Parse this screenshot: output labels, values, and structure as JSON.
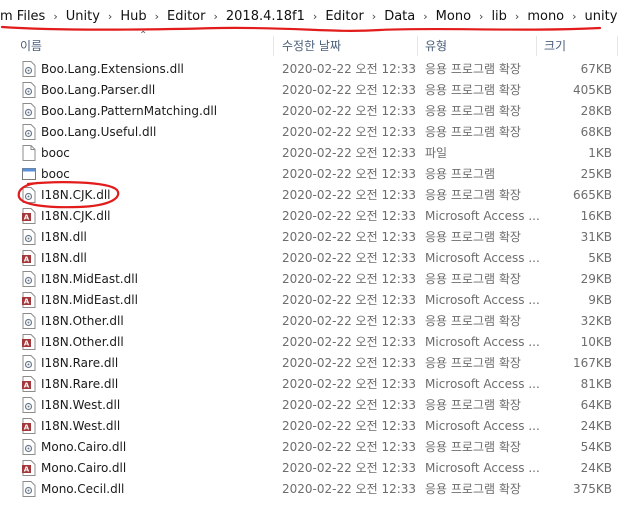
{
  "breadcrumb": [
    "m Files",
    "Unity",
    "Hub",
    "Editor",
    "2018.4.18f1",
    "Editor",
    "Data",
    "Mono",
    "lib",
    "mono",
    "unity"
  ],
  "columns": {
    "name": "이름",
    "date": "수정한 날짜",
    "type": "유형",
    "size": "크기"
  },
  "files": [
    {
      "name": "Boo.Lang.Extensions.dll",
      "date": "2020-02-22 오전 12:33",
      "type": "응용 프로그램 확장",
      "size": "67KB",
      "icon": "dll-icon"
    },
    {
      "name": "Boo.Lang.Parser.dll",
      "date": "2020-02-22 오전 12:33",
      "type": "응용 프로그램 확장",
      "size": "405KB",
      "icon": "dll-icon"
    },
    {
      "name": "Boo.Lang.PatternMatching.dll",
      "date": "2020-02-22 오전 12:33",
      "type": "응용 프로그램 확장",
      "size": "28KB",
      "icon": "dll-icon"
    },
    {
      "name": "Boo.Lang.Useful.dll",
      "date": "2020-02-22 오전 12:33",
      "type": "응용 프로그램 확장",
      "size": "68KB",
      "icon": "dll-icon"
    },
    {
      "name": "booc",
      "date": "2020-02-22 오전 12:33",
      "type": "파일",
      "size": "1KB",
      "icon": "file-icon"
    },
    {
      "name": "booc",
      "date": "2020-02-22 오전 12:33",
      "type": "응용 프로그램",
      "size": "25KB",
      "icon": "exe-icon"
    },
    {
      "name": "I18N.CJK.dll",
      "date": "2020-02-22 오전 12:33",
      "type": "응용 프로그램 확장",
      "size": "665KB",
      "icon": "dll-icon"
    },
    {
      "name": "I18N.CJK.dll",
      "date": "2020-02-22 오전 12:33",
      "type": "Microsoft Access ...",
      "size": "16KB",
      "icon": "access-icon"
    },
    {
      "name": "I18N.dll",
      "date": "2020-02-22 오전 12:33",
      "type": "응용 프로그램 확장",
      "size": "31KB",
      "icon": "dll-icon"
    },
    {
      "name": "I18N.dll",
      "date": "2020-02-22 오전 12:33",
      "type": "Microsoft Access ...",
      "size": "5KB",
      "icon": "access-icon"
    },
    {
      "name": "I18N.MidEast.dll",
      "date": "2020-02-22 오전 12:33",
      "type": "응용 프로그램 확장",
      "size": "29KB",
      "icon": "dll-icon"
    },
    {
      "name": "I18N.MidEast.dll",
      "date": "2020-02-22 오전 12:33",
      "type": "Microsoft Access ...",
      "size": "9KB",
      "icon": "access-icon"
    },
    {
      "name": "I18N.Other.dll",
      "date": "2020-02-22 오전 12:33",
      "type": "응용 프로그램 확장",
      "size": "32KB",
      "icon": "dll-icon"
    },
    {
      "name": "I18N.Other.dll",
      "date": "2020-02-22 오전 12:33",
      "type": "Microsoft Access ...",
      "size": "10KB",
      "icon": "access-icon"
    },
    {
      "name": "I18N.Rare.dll",
      "date": "2020-02-22 오전 12:33",
      "type": "응용 프로그램 확장",
      "size": "167KB",
      "icon": "dll-icon"
    },
    {
      "name": "I18N.Rare.dll",
      "date": "2020-02-22 오전 12:33",
      "type": "Microsoft Access ...",
      "size": "81KB",
      "icon": "access-icon"
    },
    {
      "name": "I18N.West.dll",
      "date": "2020-02-22 오전 12:33",
      "type": "응용 프로그램 확장",
      "size": "64KB",
      "icon": "dll-icon"
    },
    {
      "name": "I18N.West.dll",
      "date": "2020-02-22 오전 12:33",
      "type": "Microsoft Access ...",
      "size": "24KB",
      "icon": "access-icon"
    },
    {
      "name": "Mono.Cairo.dll",
      "date": "2020-02-22 오전 12:33",
      "type": "응용 프로그램 확장",
      "size": "54KB",
      "icon": "dll-icon"
    },
    {
      "name": "Mono.Cairo.dll",
      "date": "2020-02-22 오전 12:33",
      "type": "Microsoft Access ...",
      "size": "24KB",
      "icon": "access-icon"
    },
    {
      "name": "Mono.Cecil.dll",
      "date": "2020-02-22 오전 12:33",
      "type": "응용 프로그램 확장",
      "size": "375KB",
      "icon": "dll-icon"
    }
  ],
  "colors": {
    "annotation": "#e21b1b",
    "header_text": "#4c607a",
    "access_red": "#a4373a"
  }
}
